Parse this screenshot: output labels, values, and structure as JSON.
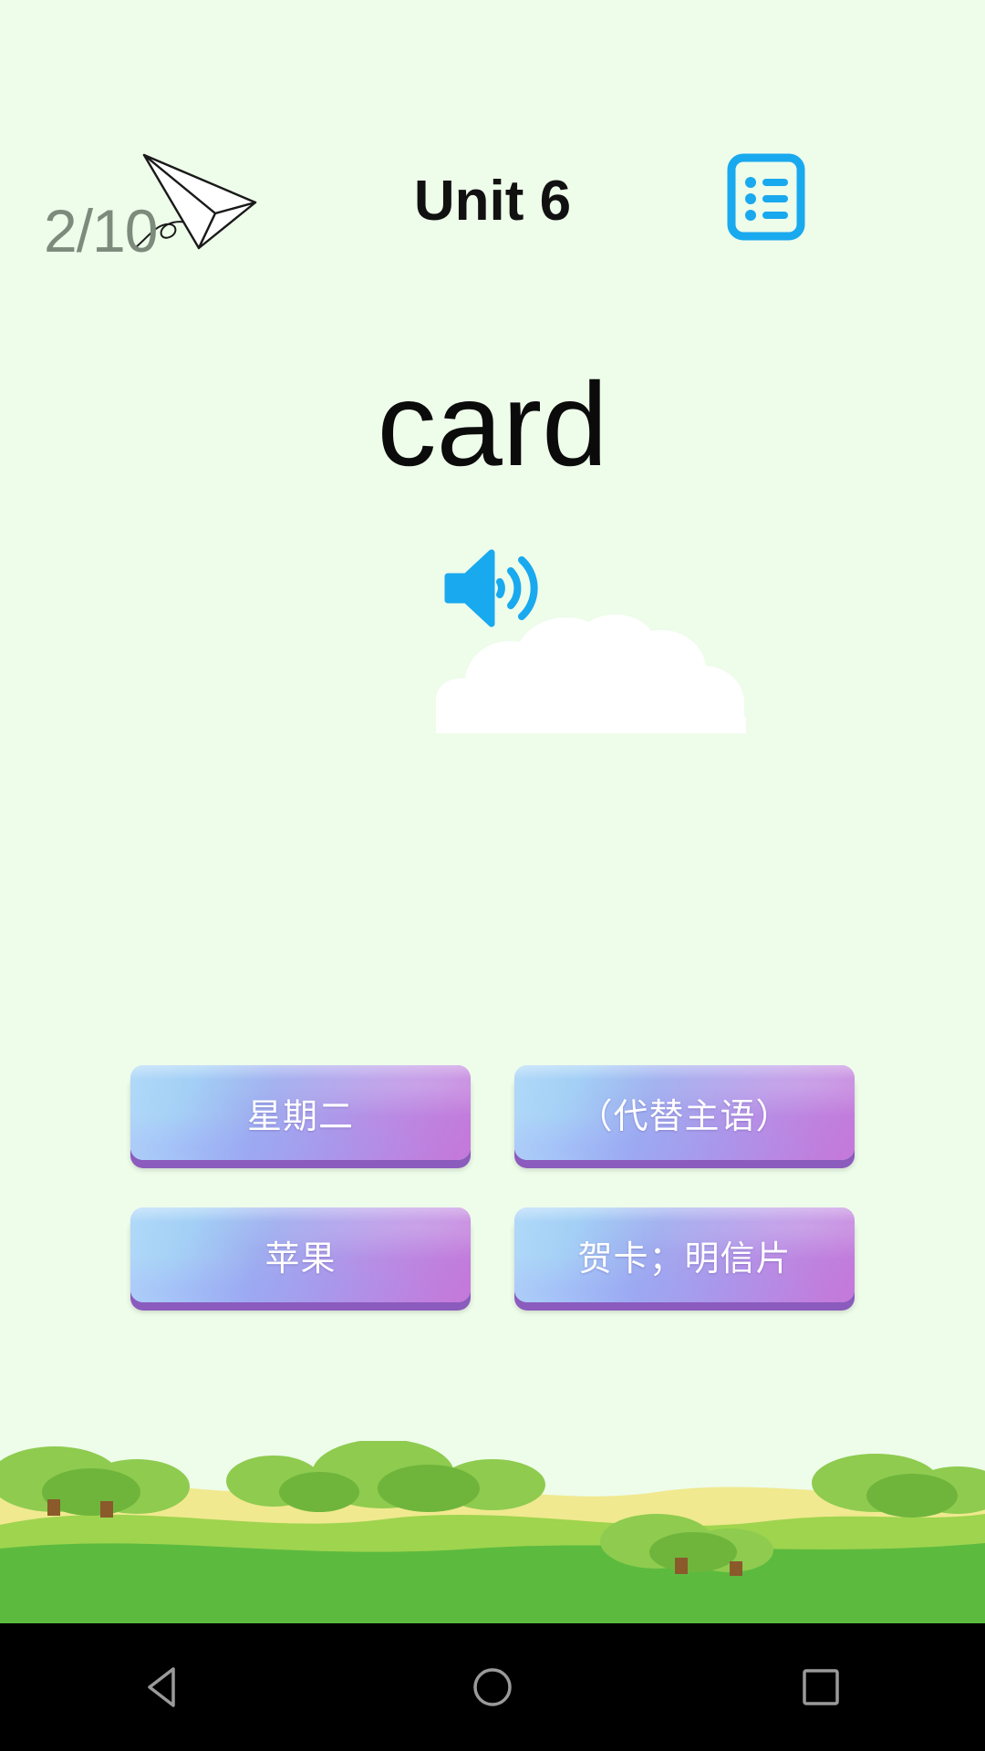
{
  "app": {
    "background_color": "#eefcea",
    "accent_blue": "#19a9ef"
  },
  "header": {
    "progress": "2/10",
    "progress_icon": "paper-plane-icon",
    "title": "Unit 6",
    "list_icon": "list-document-icon"
  },
  "main": {
    "word": "card",
    "speaker_icon": "speaker-volume-icon",
    "cloud": "cloud-decoration"
  },
  "answers": {
    "options": [
      {
        "label": "星期二"
      },
      {
        "label": "（代替主语）"
      },
      {
        "label": "苹果"
      },
      {
        "label": "贺卡；明信片"
      }
    ],
    "gradient_start": "#8ec8f6",
    "gradient_end": "#c478d9",
    "shadow_color": "#8b5bbd",
    "text_color": "#ffffff"
  },
  "scenery": {
    "grass_color": "#5cbb3f",
    "tree_color": "#7ec24b"
  },
  "navbar": {
    "back": "triangle-back-icon",
    "home": "circle-home-icon",
    "recents": "square-recents-icon"
  }
}
